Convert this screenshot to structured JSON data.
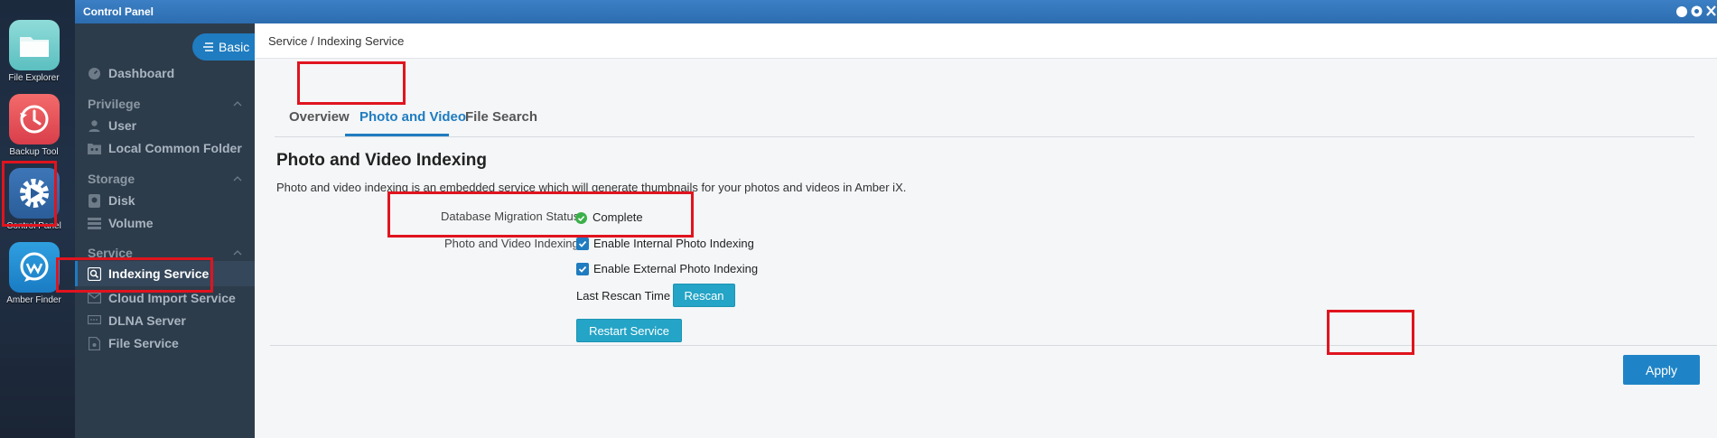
{
  "dock": {
    "items": [
      {
        "label": "File Explorer",
        "icon": "folder-icon"
      },
      {
        "label": "Backup Tool",
        "icon": "backup-clock-icon"
      },
      {
        "label": "Control Panel",
        "icon": "gear-icon"
      },
      {
        "label": "Amber Finder",
        "icon": "chat-finder-icon"
      }
    ]
  },
  "window": {
    "title": "Control Panel"
  },
  "sidebar": {
    "mode_button": "Basic",
    "dashboard": "Dashboard",
    "sections": [
      {
        "header": "Privilege",
        "items": [
          "User",
          "Local Common Folder"
        ]
      },
      {
        "header": "Storage",
        "items": [
          "Disk",
          "Volume"
        ]
      },
      {
        "header": "Service",
        "items": [
          "Indexing Service",
          "Cloud Import Service",
          "DLNA Server",
          "File Service"
        ]
      }
    ],
    "active_item": "Indexing Service"
  },
  "main": {
    "breadcrumb": "Service / Indexing Service",
    "tabs": [
      "Overview",
      "Photo and Video",
      "File Search"
    ],
    "active_tab": "Photo and Video",
    "section_title": "Photo and Video Indexing",
    "description": "Photo and video indexing is an embedded service which will generate thumbnails for your photos and videos in Amber iX.",
    "migration_label": "Database Migration Status:",
    "migration_status": "Complete",
    "indexing_label": "Photo and Video Indexing :",
    "internal_indexing": {
      "label": "Enable Internal Photo Indexing",
      "checked": true
    },
    "external_indexing": {
      "label": "Enable External Photo Indexing",
      "checked": true
    },
    "last_rescan": "Last Rescan Time : --",
    "rescan_button": "Rescan",
    "restart_button": "Restart Service",
    "apply_button": "Apply"
  },
  "colors": {
    "accent": "#1f7cc0",
    "teal_button": "#24a4c6",
    "sidebar_bg": "#2d3c4b",
    "highlight": "#e0141e",
    "success": "#3cb04a"
  }
}
